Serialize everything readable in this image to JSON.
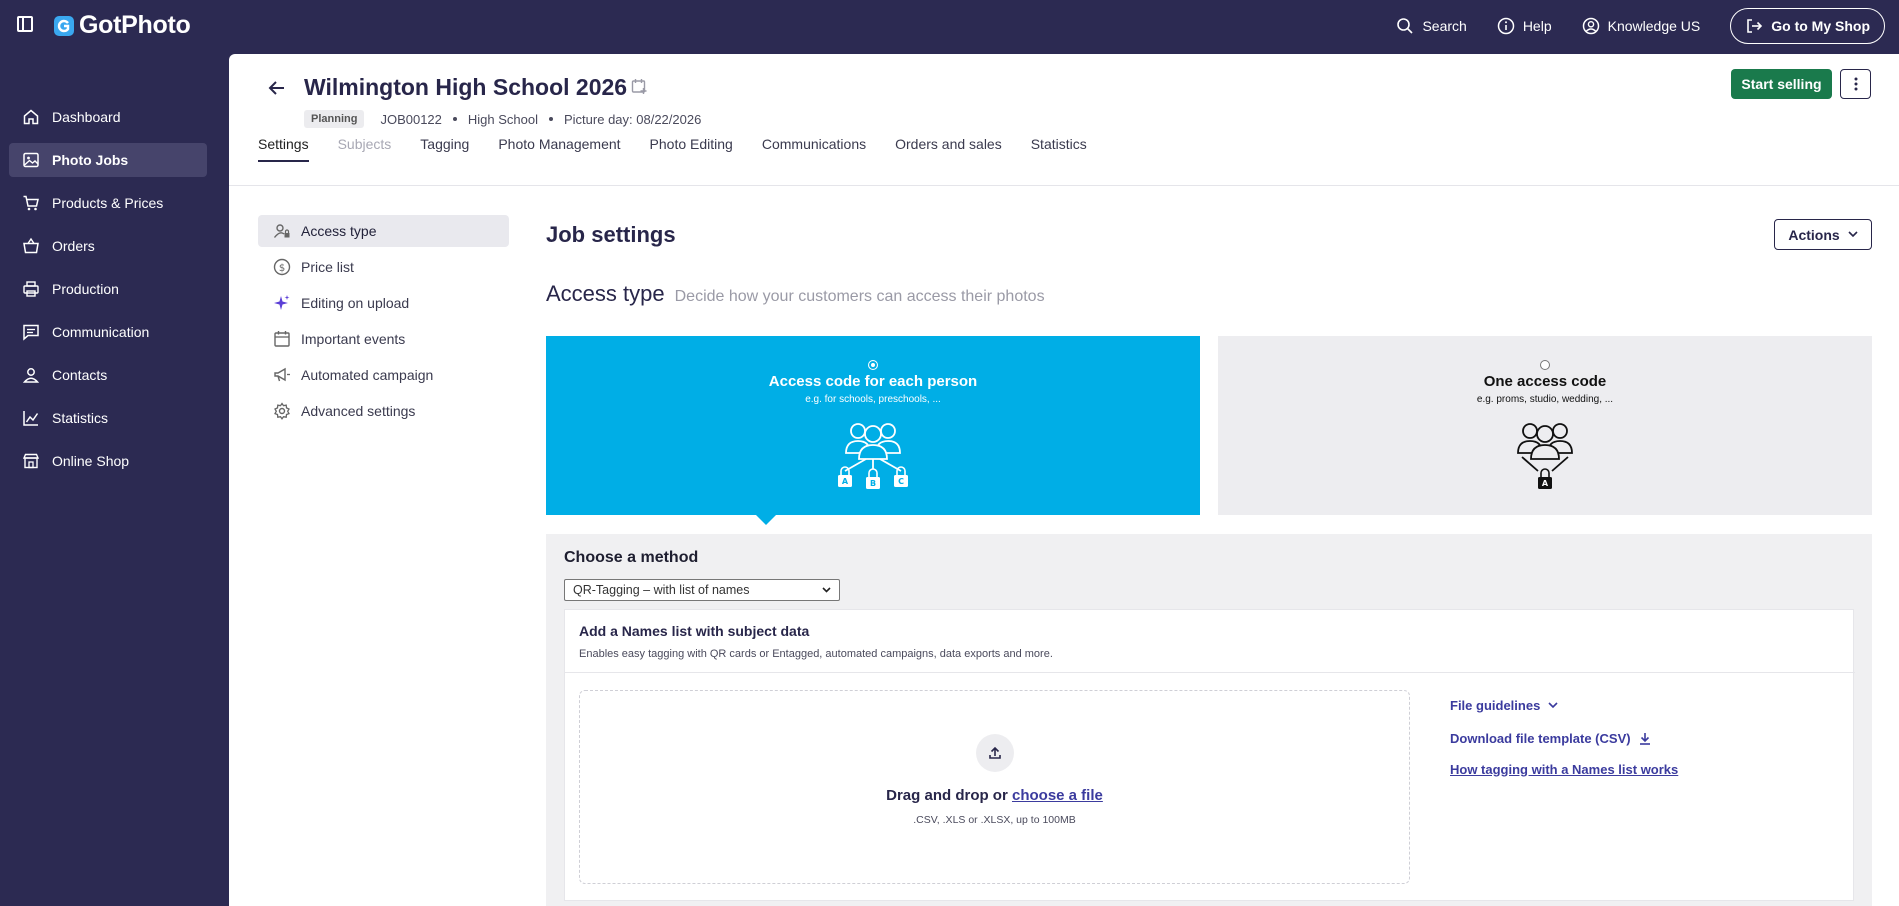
{
  "topbar": {
    "brand": "GotPhoto",
    "search": "Search",
    "help": "Help",
    "account": "Knowledge US",
    "shop_button": "Go to My Shop"
  },
  "sidebar": {
    "items": [
      {
        "label": "Dashboard",
        "icon": "home-icon"
      },
      {
        "label": "Photo Jobs",
        "icon": "image-icon"
      },
      {
        "label": "Products & Prices",
        "icon": "cart-icon"
      },
      {
        "label": "Orders",
        "icon": "basket-icon"
      },
      {
        "label": "Production",
        "icon": "printer-icon"
      },
      {
        "label": "Communication",
        "icon": "message-icon"
      },
      {
        "label": "Contacts",
        "icon": "person-icon"
      },
      {
        "label": "Statistics",
        "icon": "chart-icon"
      },
      {
        "label": "Online Shop",
        "icon": "store-icon"
      }
    ],
    "active": "Photo Jobs"
  },
  "job": {
    "title": "Wilmington High School 2026",
    "status": "Planning",
    "id": "JOB00122",
    "type": "High School",
    "picture_day": "Picture day: 08/22/2026",
    "start_button": "Start selling"
  },
  "tabs": [
    "Settings",
    "Subjects",
    "Tagging",
    "Photo Management",
    "Photo Editing",
    "Communications",
    "Orders and sales",
    "Statistics"
  ],
  "settings_nav": [
    "Access type",
    "Price list",
    "Editing on upload",
    "Important events",
    "Automated campaign",
    "Advanced settings"
  ],
  "content": {
    "heading": "Job settings",
    "actions": "Actions",
    "access_title": "Access type",
    "access_subtitle": "Decide how your customers can access their photos",
    "card_a": {
      "title": "Access code for each person",
      "subtitle": "e.g. for schools, preschools, ...",
      "locks": [
        "A",
        "B",
        "C"
      ]
    },
    "card_b": {
      "title": "One access code",
      "subtitle": "e.g. proms, studio, wedding, ...",
      "lock": "A"
    },
    "method_heading": "Choose a method",
    "method_value": "QR-Tagging – with list of names",
    "names_title": "Add a Names list with subject data",
    "names_desc": "Enables easy tagging with QR cards or Entagged, automated campaigns, data exports and more.",
    "drop_text": "Drag and drop or",
    "drop_link": "choose a file",
    "drop_hint": ".CSV, .XLS or .XLSX, up to 100MB",
    "file_guidelines": "File guidelines",
    "download_template": "Download file template (CSV)",
    "how_link": "How tagging with a Names list works"
  },
  "colors": {
    "nav_bg": "#2c2a52",
    "primary_green": "#1a7a4c",
    "access_blue": "#00aee6",
    "link": "#3b3b9e"
  }
}
